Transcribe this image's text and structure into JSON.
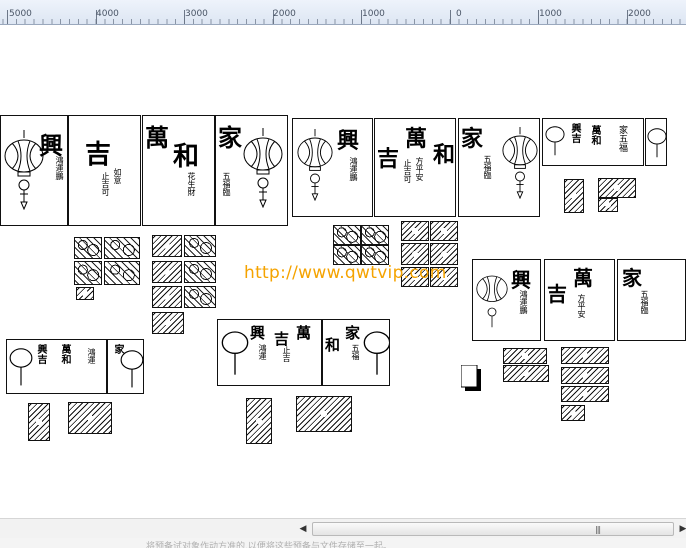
{
  "ruler": {
    "labels": [
      "5000",
      "4000",
      "3000",
      "2000",
      "1000",
      "0",
      "1000",
      "2000"
    ]
  },
  "canvas": {
    "watermark": "http://www.qwtvip.com",
    "calligraphy": {
      "c1": "興",
      "c2": "吉",
      "c3": "萬",
      "c4": "和",
      "c5": "家",
      "c6": "興",
      "c7": "吉",
      "c8": "萬",
      "c9": "和",
      "c10": "家"
    }
  },
  "scrollbar": {
    "left_arrow": "◀",
    "right_arrow": "▶",
    "grip": "|||"
  },
  "status": {
    "text": "将预备试对象作动方准的,以便将这些预备与文件存储至一起。"
  },
  "colors": {
    "watermark": "#f5a300",
    "ruler_bg": "#e6edf7",
    "ink": "#000000"
  }
}
